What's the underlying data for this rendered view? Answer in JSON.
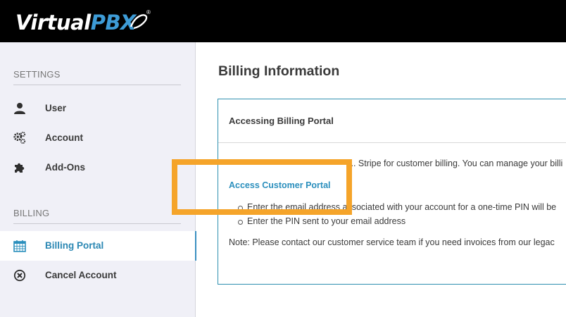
{
  "header": {
    "logo_primary": "Virtual",
    "logo_accent": "PBX",
    "logo_reg": "®"
  },
  "sidebar": {
    "settings_label": "SETTINGS",
    "billing_label": "BILLING",
    "items": [
      {
        "label": "User",
        "icon": "user-icon"
      },
      {
        "label": "Account",
        "icon": "gears-icon"
      },
      {
        "label": "Add-Ons",
        "icon": "puzzle-icon"
      },
      {
        "label": "Billing Portal",
        "icon": "calendar-icon",
        "active": true
      },
      {
        "label": "Cancel Account",
        "icon": "close-circle-icon"
      }
    ]
  },
  "main": {
    "title": "Billing Information",
    "card": {
      "title": "Accessing Billing Portal",
      "intro": "... Stripe for customer billing. You can manage your billi",
      "link": "Access Customer Portal",
      "bullets": [
        "Enter the email address associated with your account for a one-time PIN will be",
        "Enter the PIN sent to your email address"
      ],
      "note": "Note: Please contact our customer service team if you need invoices from our legac"
    }
  },
  "colors": {
    "accent": "#2b8fbd",
    "highlight": "#f5a42a",
    "sidebar_bg": "#f0f0f7"
  }
}
